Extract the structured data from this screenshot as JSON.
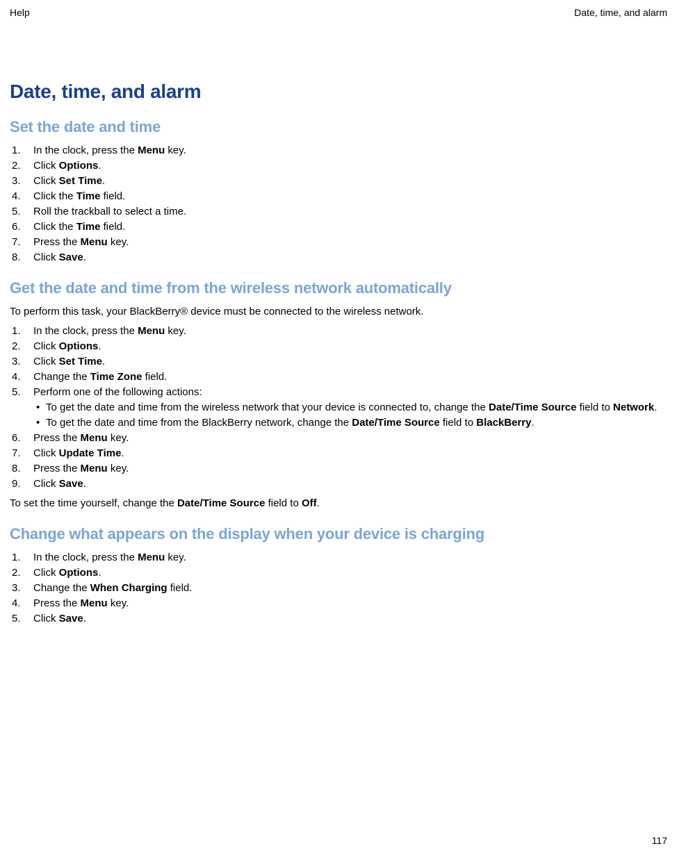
{
  "header": {
    "left": "Help",
    "right": "Date, time, and alarm"
  },
  "title": "Date, time, and alarm",
  "section1": {
    "heading": "Set the date and time",
    "step1_a": "In the clock, press the ",
    "step1_b": "Menu",
    "step1_c": " key.",
    "step2_a": "Click ",
    "step2_b": "Options",
    "step2_c": ".",
    "step3_a": "Click ",
    "step3_b": "Set Time",
    "step3_c": ".",
    "step4_a": "Click the ",
    "step4_b": "Time",
    "step4_c": " field.",
    "step5": "Roll the trackball to select a time.",
    "step6_a": "Click the ",
    "step6_b": "Time",
    "step6_c": " field.",
    "step7_a": "Press the ",
    "step7_b": "Menu",
    "step7_c": " key.",
    "step8_a": "Click ",
    "step8_b": "Save",
    "step8_c": "."
  },
  "section2": {
    "heading": "Get the date and time from the wireless network automatically",
    "intro": "To perform this task, your BlackBerry® device must be connected to the wireless network.",
    "step1_a": "In the clock, press the ",
    "step1_b": "Menu",
    "step1_c": " key.",
    "step2_a": "Click ",
    "step2_b": "Options",
    "step2_c": ".",
    "step3_a": "Click ",
    "step3_b": "Set Time",
    "step3_c": ".",
    "step4_a": "Change the ",
    "step4_b": "Time Zone",
    "step4_c": " field.",
    "step5": "Perform one of the following actions:",
    "bullet1_a": "To get the date and time from the wireless network that your device is connected to, change the ",
    "bullet1_b": "Date/Time Source",
    "bullet1_c": " field to ",
    "bullet1_d": "Network",
    "bullet1_e": ".",
    "bullet2_a": "To get the date and time from the BlackBerry network, change the ",
    "bullet2_b": "Date/Time Source",
    "bullet2_c": " field to ",
    "bullet2_d": "BlackBerry",
    "bullet2_e": ".",
    "step6_a": "Press the ",
    "step6_b": "Menu",
    "step6_c": " key.",
    "step7_a": "Click ",
    "step7_b": "Update Time",
    "step7_c": ".",
    "step8_a": "Press the ",
    "step8_b": "Menu",
    "step8_c": " key.",
    "step9_a": "Click ",
    "step9_b": "Save",
    "step9_c": ".",
    "outro_a": "To set the time yourself, change the ",
    "outro_b": "Date/Time Source",
    "outro_c": " field to ",
    "outro_d": "Off",
    "outro_e": "."
  },
  "section3": {
    "heading": "Change what appears on the display when your device is charging",
    "step1_a": "In the clock, press the ",
    "step1_b": "Menu",
    "step1_c": " key.",
    "step2_a": "Click ",
    "step2_b": "Options",
    "step2_c": ".",
    "step3_a": "Change the ",
    "step3_b": "When Charging",
    "step3_c": " field.",
    "step4_a": "Press the ",
    "step4_b": "Menu",
    "step4_c": " key.",
    "step5_a": "Click ",
    "step5_b": "Save",
    "step5_c": "."
  },
  "page_number": "117"
}
